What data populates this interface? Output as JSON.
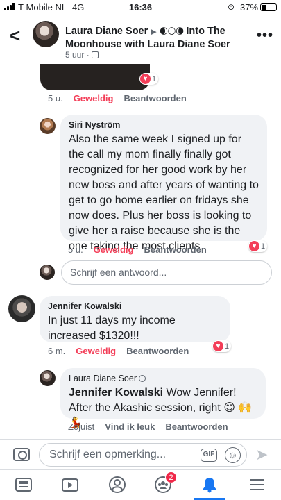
{
  "status_bar": {
    "carrier": "T-Mobile NL",
    "network": "4G",
    "time": "16:36",
    "battery": "37%",
    "battery_level": 0.37
  },
  "header": {
    "title_person": "Laura Diane Soer",
    "title_arrow": "▶",
    "title_moons": "🌒🌕🌘",
    "title_group": "Into The Moonhouse with Laura Diane Soer",
    "subtitle_time": "5 uur",
    "subtitle_sep": "·",
    "icon_names": [
      "back-icon",
      "more-icon",
      "audience-icon"
    ]
  },
  "top_comment": {
    "time": "5 u.",
    "reaction_label": "Geweldig",
    "reply_label": "Beantwoorden",
    "reaction_count": "1"
  },
  "comments": [
    {
      "name": "Siri Nyström",
      "text": "Also the same week I signed up for the call my mom finally finally got recognized for her good work by her new boss and after years of wanting to get to go home earlier on fridays she now does. Plus her boss is looking to give her a raise because she is the one taking the most clients",
      "time": "5 u.",
      "reaction_label": "Geweldig",
      "reply_label": "Beantwoorden",
      "reaction_count": "1"
    },
    {
      "name": "Jennifer Kowalski",
      "text": "In just 11 days my income increased $1320!!!",
      "time": "6 m.",
      "reaction_label": "Geweldig",
      "reply_label": "Beantwoorden",
      "reaction_count": "1"
    },
    {
      "name": "Laura Diane Soer",
      "tag": "Jennifer Kowalski",
      "text": "Wow Jennifer! After the Akashic session, right",
      "emoji": "😊 🙌 💃",
      "time": "Zojuist",
      "like_label": "Vind ik leuk",
      "reply_label": "Beantwoorden"
    }
  ],
  "reply_box": {
    "placeholder": "Schrijf een antwoord..."
  },
  "composer": {
    "placeholder": "Schrijf een opmerking...",
    "gif_label": "GIF",
    "icon_names": [
      "camera-icon",
      "gif-icon",
      "emoji-icon",
      "send-icon"
    ]
  },
  "tabbar": {
    "friends_badge": "2",
    "active_tab": "notifications",
    "accent_color": "#1877f2"
  },
  "colors": {
    "love": "#f33e58",
    "bubble": "#f0f2f5",
    "secondary_text": "#606770"
  }
}
